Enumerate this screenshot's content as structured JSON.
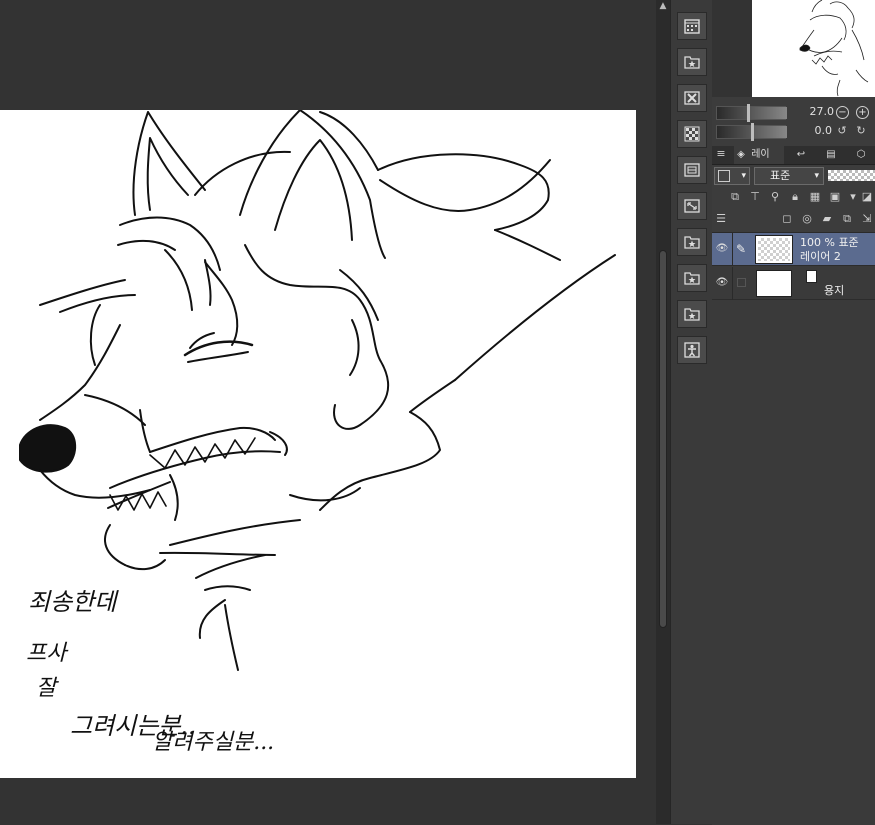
{
  "navigator": {
    "zoom_value": "27.0",
    "rotate_value": "0.0"
  },
  "layer_panel": {
    "tab_label": "레이",
    "blend_mode": "표준",
    "layers": [
      {
        "opacity_blend": "100 % 표준",
        "name": "레이어 2",
        "selected": true,
        "thumbnail": "transparent"
      },
      {
        "opacity_blend": "",
        "name": "용지",
        "selected": false,
        "thumbnail": "white"
      }
    ]
  },
  "canvas": {
    "handwriting_lines": [
      "죄송한데",
      "프사",
      "잘",
      "그려시는분..",
      "알려주실분..."
    ]
  },
  "icons": {
    "toolstrip": [
      "calendar-icon",
      "star-folder-icon",
      "close-box-icon",
      "checker-grid-icon",
      "layout-icon",
      "transform-icon",
      "star-folder-icon",
      "star-folder-icon",
      "star-folder-icon",
      "figure-icon"
    ]
  },
  "colors": {
    "canvas_bg": "#333333",
    "paper": "#ffffff",
    "panel": "#3c3c3c",
    "selection": "#5b6b8f"
  }
}
